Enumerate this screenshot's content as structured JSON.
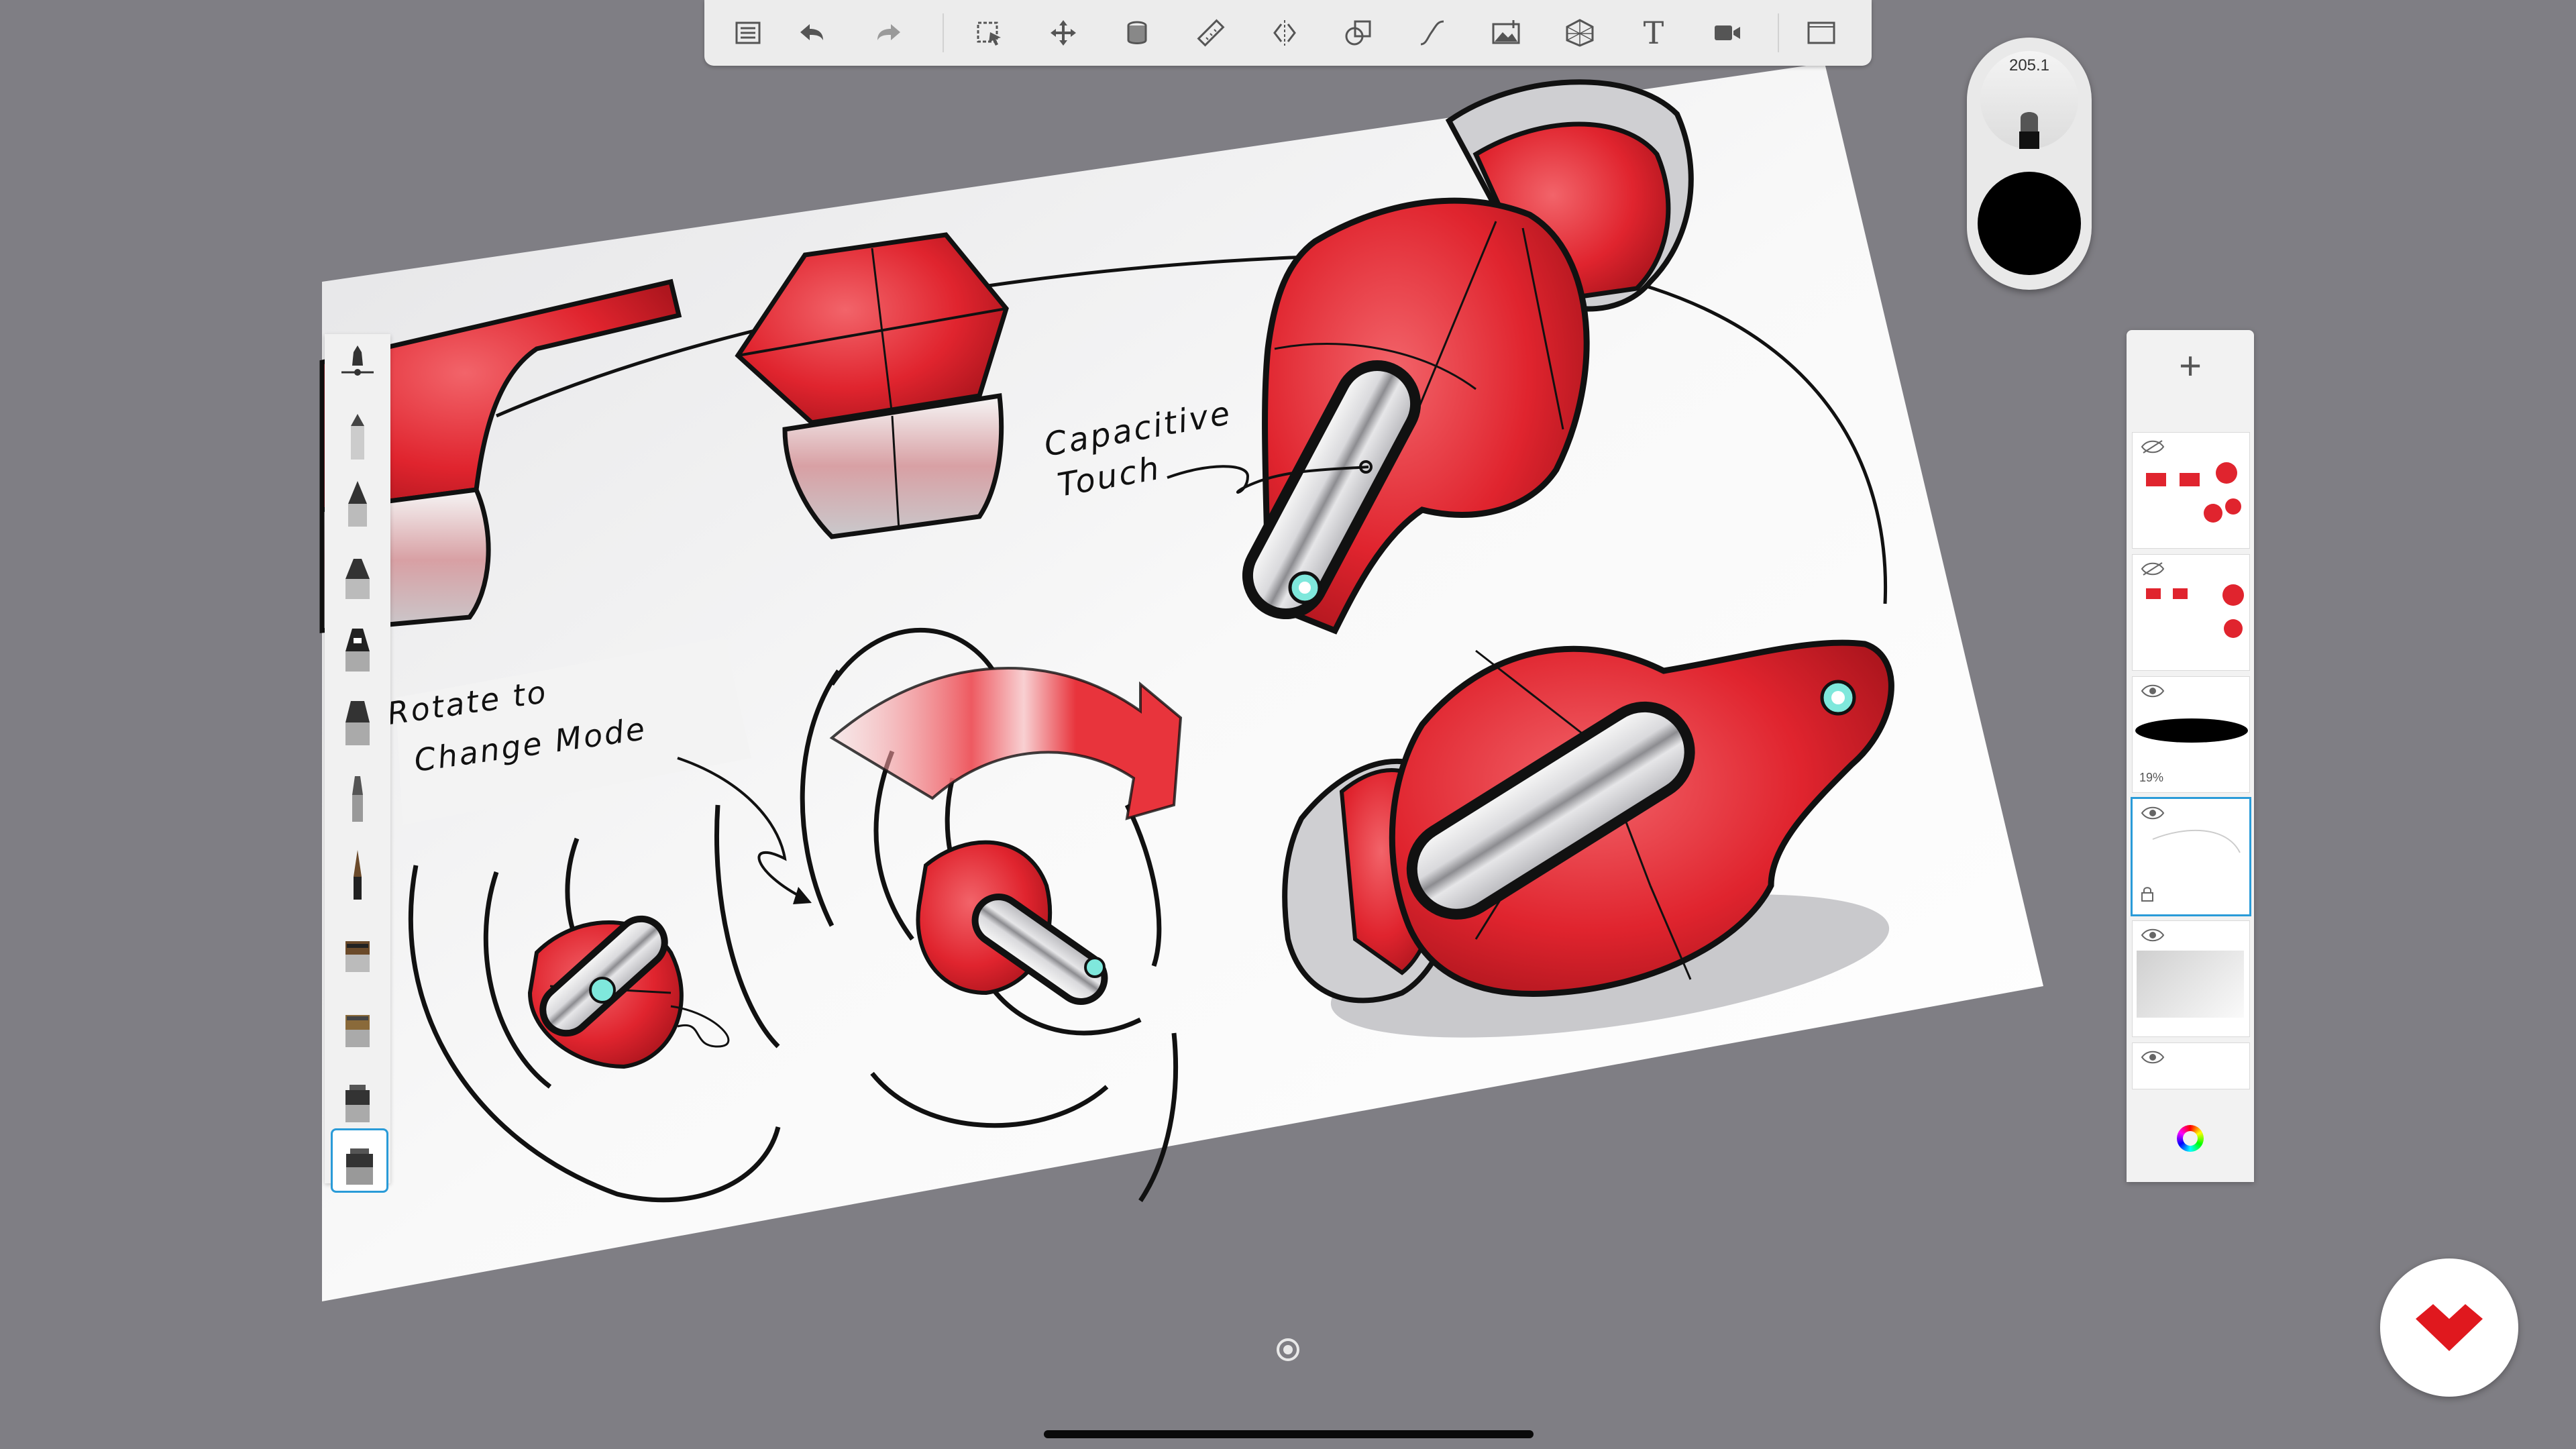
{
  "app": {
    "name": "Sketchbook"
  },
  "toolbar": {
    "items": [
      {
        "name": "layers-menu-icon"
      },
      {
        "name": "undo-icon"
      },
      {
        "name": "redo-icon"
      },
      {
        "name": "selection-icon"
      },
      {
        "name": "transform-icon"
      },
      {
        "name": "fill-icon"
      },
      {
        "name": "ruler-icon"
      },
      {
        "name": "symmetry-icon"
      },
      {
        "name": "shape-icon"
      },
      {
        "name": "curve-icon"
      },
      {
        "name": "add-image-icon"
      },
      {
        "name": "perspective-guide-icon"
      },
      {
        "name": "text-icon"
      },
      {
        "name": "record-icon"
      },
      {
        "name": "fullscreen-icon"
      }
    ],
    "text_tool_glyph": "T"
  },
  "brush_puck": {
    "size_value": "205.1",
    "color": "#000000"
  },
  "canvas": {
    "annotations": {
      "capacitive_line1": "Capacitive",
      "capacitive_line2": "Touch",
      "rotate_line1": "Rotate to",
      "rotate_line2": "Change Mode"
    },
    "colors": {
      "accent_red": "#e02a34",
      "teal_button": "#7fe8dc",
      "outline": "#111111"
    }
  },
  "brush_palette": {
    "selected_index": 11,
    "brushes": [
      "brush-1",
      "brush-2",
      "brush-3",
      "brush-4",
      "brush-5",
      "brush-6",
      "brush-7",
      "brush-8",
      "brush-9",
      "brush-10",
      "brush-11",
      "brush-12"
    ]
  },
  "layers_panel": {
    "add_label": "+",
    "layers": [
      {
        "name": "layer-sketch-top",
        "visible": false
      },
      {
        "name": "layer-sketch-2",
        "visible": false
      },
      {
        "name": "layer-shadow",
        "visible": true,
        "opacity_label": "19%"
      },
      {
        "name": "layer-lines",
        "visible": true,
        "active": true
      },
      {
        "name": "layer-gradient",
        "visible": true
      },
      {
        "name": "layer-bottom",
        "visible": true
      }
    ]
  },
  "accent_colors": {
    "selection_blue": "#2a9bd8",
    "logo_red": "#e0181e"
  }
}
